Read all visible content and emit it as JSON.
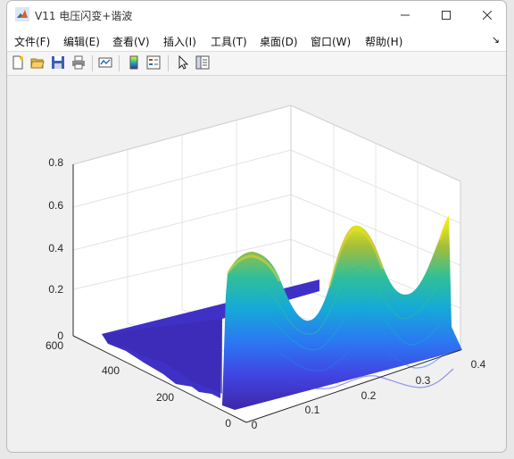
{
  "window": {
    "title": "V11 电压闪变+谐波"
  },
  "menu": [
    {
      "label": "文件(F)"
    },
    {
      "label": "编辑(E)"
    },
    {
      "label": "查看(V)"
    },
    {
      "label": "插入(I)"
    },
    {
      "label": "工具(T)"
    },
    {
      "label": "桌面(D)"
    },
    {
      "label": "窗口(W)"
    },
    {
      "label": "帮助(H)"
    }
  ],
  "toolbar": [
    "new-figure-icon",
    "open-file-icon",
    "save-icon",
    "print-icon",
    "link-plot-icon",
    "colorbar-icon",
    "legend-icon",
    "pointer-icon",
    "property-inspector-icon"
  ],
  "chart_data": {
    "type": "surface",
    "x_ticks": [
      "0",
      "0.1",
      "0.2",
      "0.3",
      "0.4"
    ],
    "y_ticks": [
      "0",
      "200",
      "400",
      "600"
    ],
    "z_ticks": [
      "0",
      "0.2",
      "0.4",
      "0.6",
      "0.8"
    ],
    "xlim": [
      0,
      0.4
    ],
    "ylim": [
      0,
      600
    ],
    "zlim": [
      0,
      0.8
    ],
    "grid": true,
    "colormap": "parula",
    "surface_peaks": [
      {
        "x": 0.0,
        "z": 0.36
      },
      {
        "x": 0.16,
        "z": 0.53
      },
      {
        "x": 0.4,
        "z": 0.55
      }
    ]
  }
}
